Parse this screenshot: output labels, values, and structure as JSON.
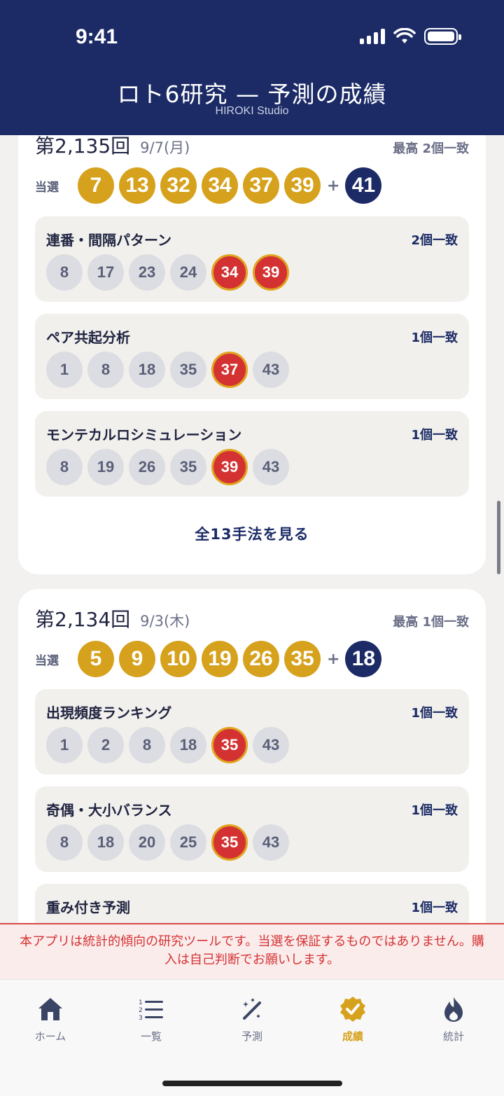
{
  "status": {
    "time": "9:41"
  },
  "header": {
    "title": "ロト6研究 — 予測の成績",
    "subtitle": "HIROKI Studio"
  },
  "cards": [
    {
      "draw_no": "第2,135回",
      "date": "9/7(月)",
      "best": "最高 2個一致",
      "win_label": "当選",
      "winning": [
        "7",
        "13",
        "32",
        "34",
        "37",
        "39"
      ],
      "plus": "+",
      "bonus": "41",
      "methods": [
        {
          "name": "連番・間隔パターン",
          "match": "2個一致",
          "numbers": [
            "8",
            "17",
            "23",
            "24",
            "34",
            "39"
          ],
          "hits": [
            false,
            false,
            false,
            false,
            true,
            true
          ]
        },
        {
          "name": "ペア共起分析",
          "match": "1個一致",
          "numbers": [
            "1",
            "8",
            "18",
            "35",
            "37",
            "43"
          ],
          "hits": [
            false,
            false,
            false,
            false,
            true,
            false
          ]
        },
        {
          "name": "モンテカルロシミュレーション",
          "match": "1個一致",
          "numbers": [
            "8",
            "19",
            "26",
            "35",
            "39",
            "43"
          ],
          "hits": [
            false,
            false,
            false,
            false,
            true,
            false
          ]
        }
      ],
      "see_all": "全13手法を見る"
    },
    {
      "draw_no": "第2,134回",
      "date": "9/3(木)",
      "best": "最高 1個一致",
      "win_label": "当選",
      "winning": [
        "5",
        "9",
        "10",
        "19",
        "26",
        "35"
      ],
      "plus": "+",
      "bonus": "18",
      "methods": [
        {
          "name": "出現頻度ランキング",
          "match": "1個一致",
          "numbers": [
            "1",
            "2",
            "8",
            "18",
            "35",
            "43"
          ],
          "hits": [
            false,
            false,
            false,
            false,
            true,
            false
          ]
        },
        {
          "name": "奇偶・大小バランス",
          "match": "1個一致",
          "numbers": [
            "8",
            "18",
            "20",
            "25",
            "35",
            "43"
          ],
          "hits": [
            false,
            false,
            false,
            false,
            true,
            false
          ]
        },
        {
          "name": "重み付き予測",
          "match": "1個一致",
          "numbers": [],
          "hits": []
        }
      ]
    }
  ],
  "disclaimer": "本アプリは統計的傾向の研究ツールです。当選を保証するものではありません。購入は自己判断でお願いします。",
  "tabs": [
    {
      "label": "ホーム",
      "icon": "home-icon"
    },
    {
      "label": "一覧",
      "icon": "list-icon"
    },
    {
      "label": "予測",
      "icon": "magic-wand-icon"
    },
    {
      "label": "成績",
      "icon": "badge-check-icon",
      "active": true
    },
    {
      "label": "統計",
      "icon": "flame-icon"
    }
  ],
  "colors": {
    "navy": "#1c2b66",
    "gold": "#d6a21d",
    "hit_red": "#d43232"
  }
}
